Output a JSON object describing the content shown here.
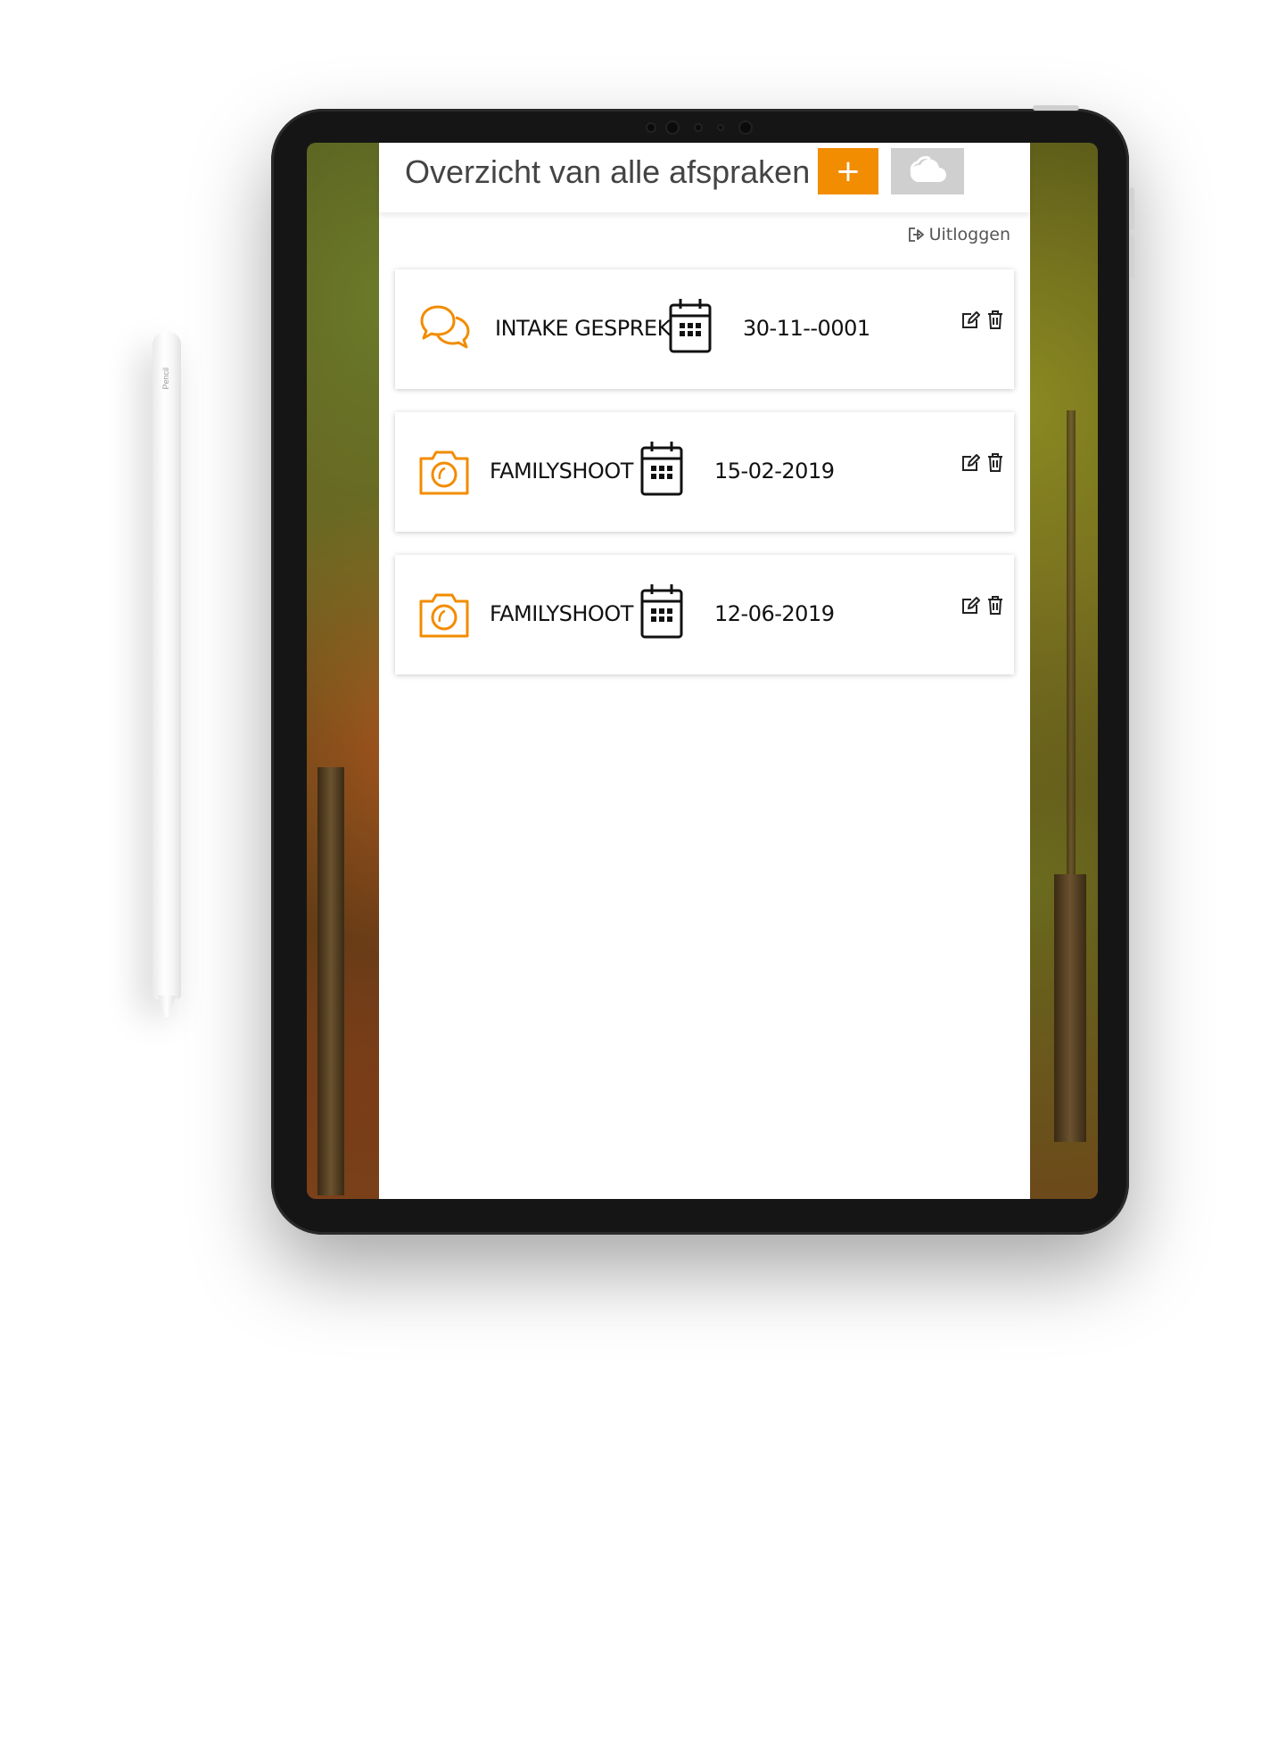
{
  "device": {
    "pencil_label": "Pencil"
  },
  "header": {
    "title": "Overzicht van alle afspraken",
    "add_label": "+"
  },
  "logout_label": "Uitloggen",
  "appointments": [
    {
      "type": "INTAKE GESPREK",
      "icon": "chat-bubbles-icon",
      "date": "30-11--0001"
    },
    {
      "type": "FAMILYSHOOT",
      "icon": "camera-icon",
      "date": "15-02-2019"
    },
    {
      "type": "FAMILYSHOOT",
      "icon": "camera-icon",
      "date": "12-06-2019"
    }
  ],
  "colors": {
    "accent": "#f28c00",
    "cloud_button": "#cfcfcf",
    "text": "#111111"
  }
}
